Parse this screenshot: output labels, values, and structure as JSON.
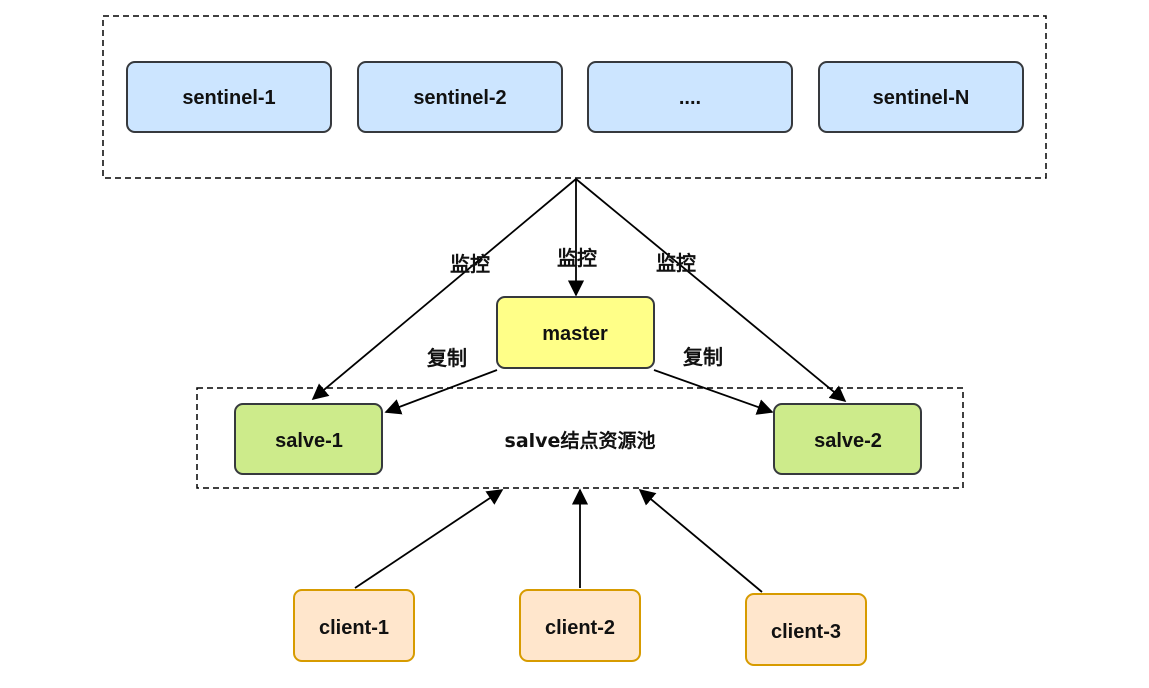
{
  "sentinels": {
    "s1": "sentinel-1",
    "s2": "sentinel-2",
    "s3": "....",
    "s4": "sentinel-N"
  },
  "master": "master",
  "slaves": {
    "s1": "salve-1",
    "s2": "salve-2"
  },
  "pool_label": "salve结点资源池",
  "edges": {
    "monitor_left": "监控",
    "monitor_center": "监控",
    "monitor_right": "监控",
    "replicate_left": "复制",
    "replicate_right": "复制"
  },
  "clients": {
    "c1": "client-1",
    "c2": "client-2",
    "c3": "client-3"
  },
  "colors": {
    "sentinel_fill": "#cce5ff",
    "master_fill": "#ffff88",
    "master_stroke": "#36393d",
    "slave_fill": "#cdeb8b",
    "client_fill": "#ffe6cc",
    "client_stroke": "#d79b00"
  }
}
